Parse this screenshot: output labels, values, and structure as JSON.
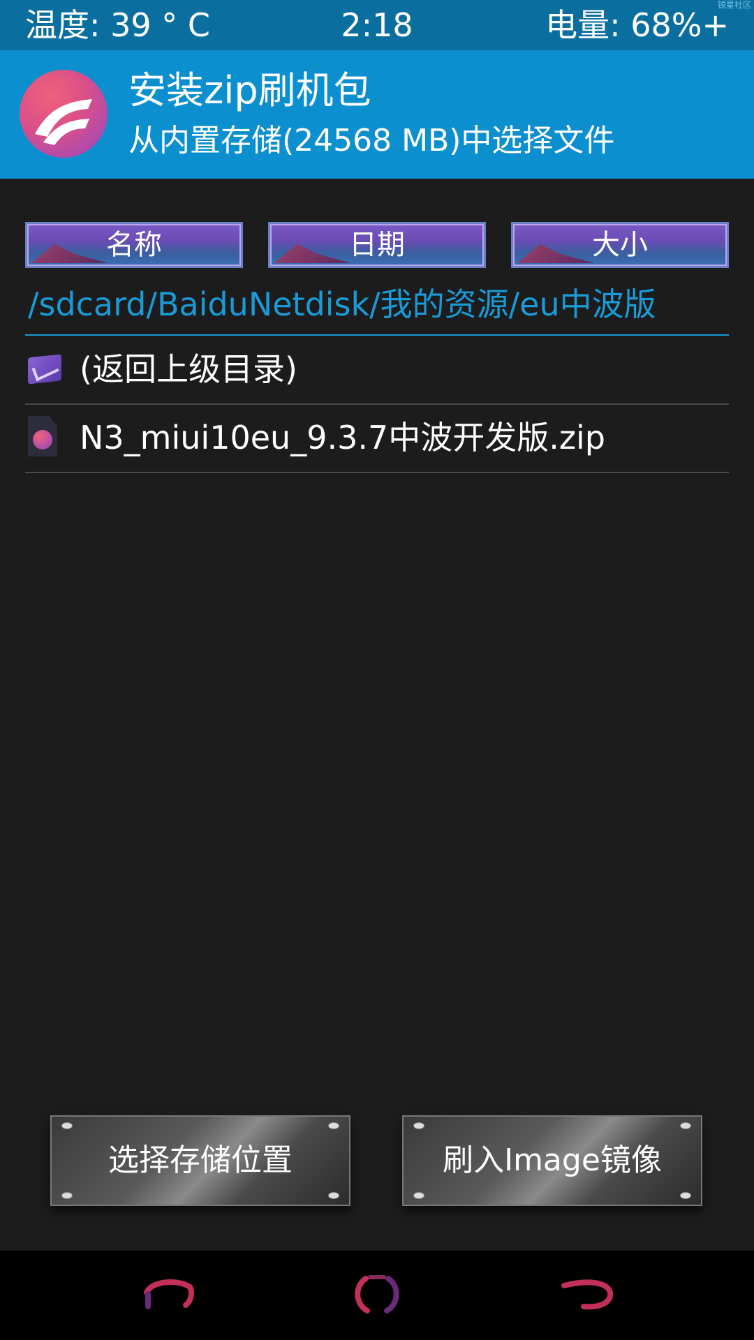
{
  "status_bar": {
    "temperature": "温度: 39 ° C",
    "time": "2:18",
    "battery": "电量: 68%+",
    "watermark": "锐星社区"
  },
  "header": {
    "title": "安装zip刷机包",
    "subtitle": "从内置存储(24568 MB)中选择文件"
  },
  "sort_buttons": [
    {
      "label": "名称"
    },
    {
      "label": "日期"
    },
    {
      "label": "大小"
    }
  ],
  "current_path": "/sdcard/BaiduNetdisk/我的资源/eu中波版",
  "files": [
    {
      "label": "(返回上级目录)",
      "icon": "folder-up-icon"
    },
    {
      "label": "N3_miui10eu_9.3.7中波开发版.zip",
      "icon": "zip-file-icon"
    }
  ],
  "actions": {
    "select_storage": "选择存储位置",
    "flash_image": "刷入Image镜像"
  },
  "nav": {
    "back_icon": "back-icon",
    "home_icon": "home-icon",
    "recent_icon": "recent-apps-icon"
  },
  "colors": {
    "status_bar": "#0a6f9e",
    "header": "#0b8fce",
    "accent": "#1a9ad6",
    "background": "#1c1c1c"
  }
}
